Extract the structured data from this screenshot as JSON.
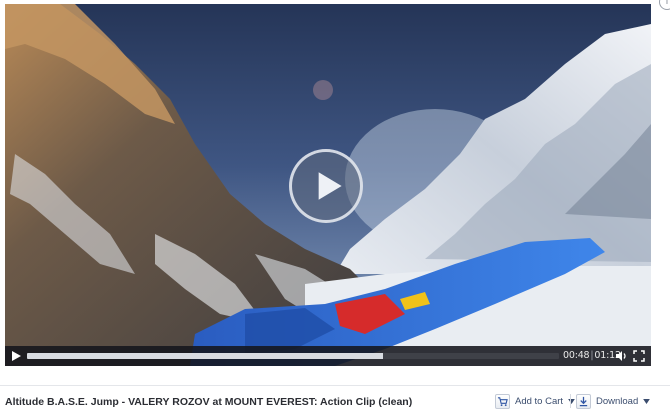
{
  "video": {
    "subject": "wingsuit jump near Mount Everest",
    "progress_fraction": 0.67,
    "time_current": "00:48",
    "time_total": "01:12",
    "time_separator": "|"
  },
  "clip": {
    "title": "Altitude B.A.S.E. Jump - VALERY ROZOV at MOUNT EVEREST: Action Clip (clean)"
  },
  "actions": {
    "add_to_cart": "Add to Cart",
    "download": "Download"
  },
  "icons": {
    "play": "play-icon",
    "big_play": "play-circle-icon",
    "volume": "speaker-icon",
    "fullscreen": "fullscreen-icon",
    "cart": "cart-icon",
    "download": "download-arrow-icon",
    "dropdown": "caret-down-icon"
  },
  "colors": {
    "control_bar": "#16181c",
    "progress_played": "#d8dbe1",
    "link_text": "#3b4d6e",
    "title_text": "#2b2d33",
    "wingsuit_blue": "#2f6fd6"
  }
}
